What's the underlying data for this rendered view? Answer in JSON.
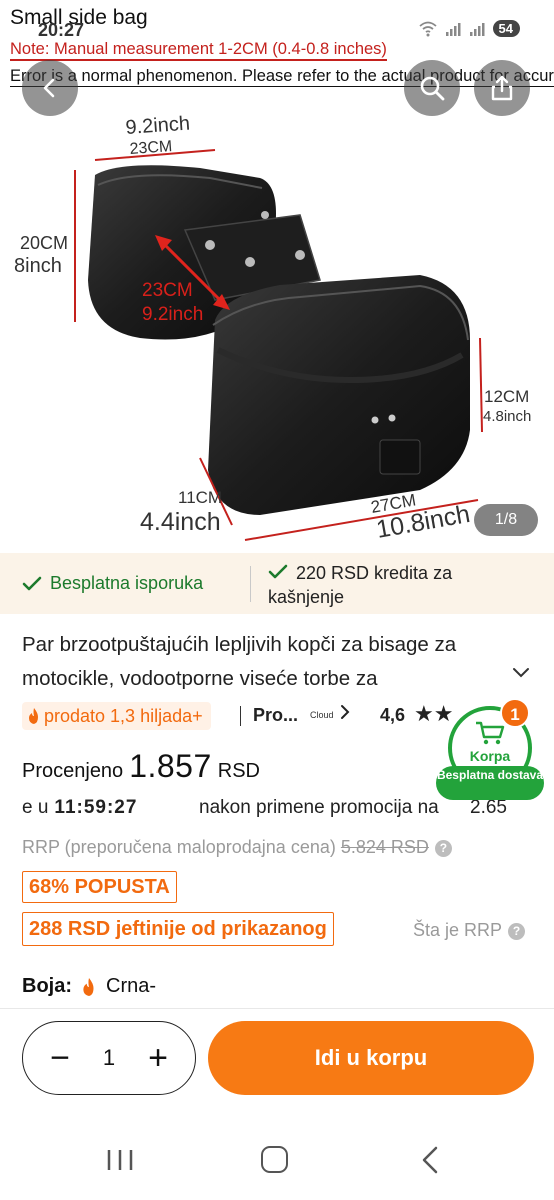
{
  "status_bar": {
    "time": "20:27",
    "battery": "54"
  },
  "hero": {
    "title": "Small side bag",
    "note": "Note: Manual measurement 1-2CM (0.4-0.8 inches)",
    "error_note": "Error is a normal phenomenon. Please refer to the actual product for accuracy",
    "dimensions": {
      "top_inch": "9.2inch",
      "top_cm": "23CM",
      "left_cm": "20CM",
      "left_inch": "8inch",
      "diag_cm": "23CM",
      "diag_inch": "9.2inch",
      "right_cm": "12CM",
      "right_inch": "4.8inch",
      "bottom_left_cm": "11CM",
      "bottom_left_inch": "4.4inch",
      "bottom_cm": "27CM",
      "bottom_inch": "10.8inch"
    },
    "page_counter": "1/8"
  },
  "shipping": {
    "free_label": "Besplatna isporuka",
    "credit_label": "220 RSD kredita za kašnjenje"
  },
  "product": {
    "title": "Par brzootpuštajućih lepljivih kopči za bisage za motocikle, vodootporne viseće torbe za",
    "sold": "prodato 1,3 hiljada+",
    "pro_label": "Pro...",
    "cloud_label": "Cloud",
    "rating": "4,6",
    "price_label": "Procenjeno",
    "price_value": "1.857",
    "price_currency": "RSD",
    "timer_prefix": "e u",
    "timer": "11:59:27",
    "promo_text": "nakon primene promocija na",
    "promo_num": "2.65",
    "rrp_label": "RRP (preporučena maloprodajna cena)",
    "rrp_value": "5.824 RSD",
    "discount": "68% POPUSTA",
    "cheaper": "288 RSD jeftinije od prikazanog",
    "what_rrp": "Šta je RRP",
    "color_label": "Boja:",
    "color_value": "Crna-"
  },
  "cart_badge": {
    "label": "Korpa",
    "free": "Besplatna dostava",
    "count": "1"
  },
  "action_bar": {
    "quantity": "1",
    "add_to_cart": "Idi u korpu"
  },
  "colors": {
    "accent": "#f77a14",
    "green": "#23a33b",
    "red_note": "#c4211d"
  }
}
